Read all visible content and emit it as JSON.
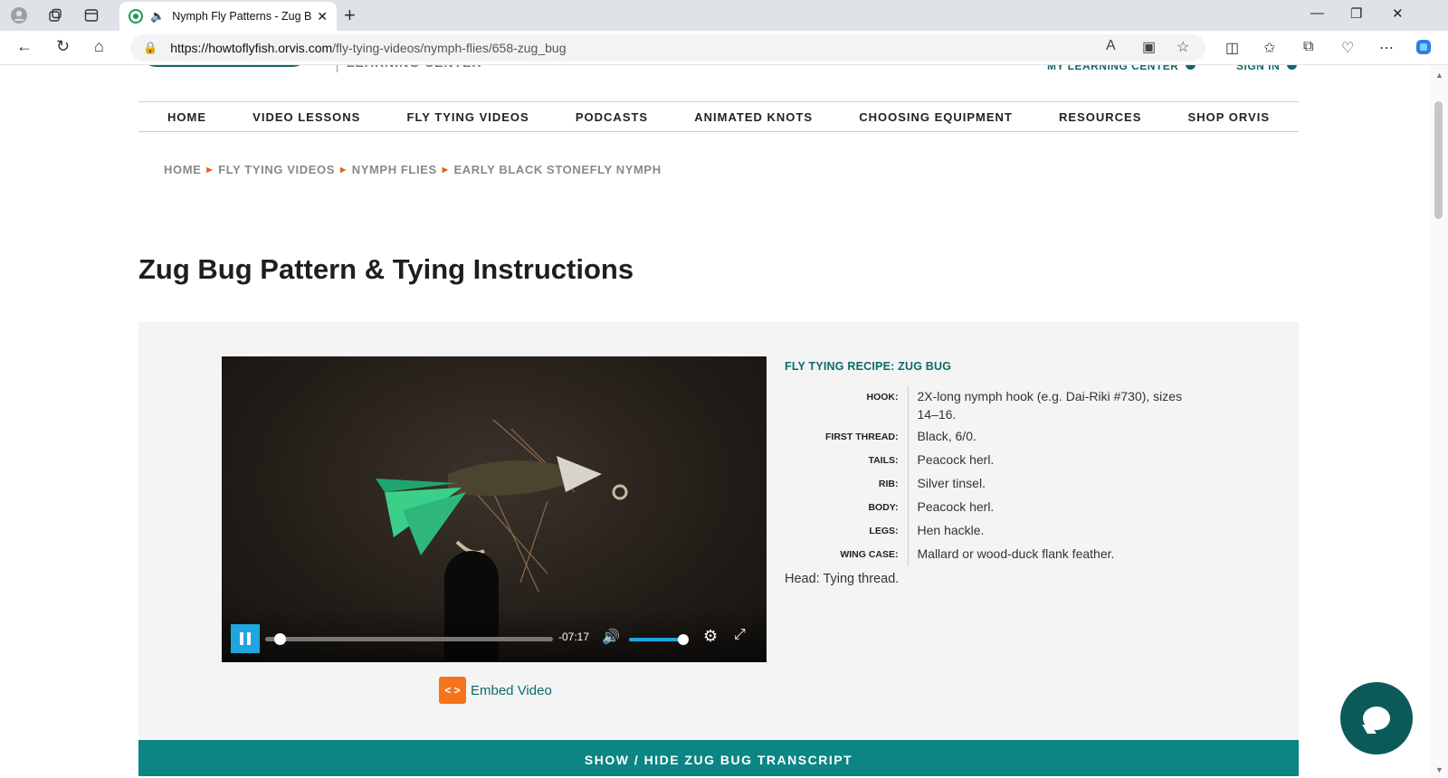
{
  "browser": {
    "tab_title": "Nymph Fly Patterns - Zug Bu",
    "tab_close": "✕",
    "new_tab": "+",
    "url_host": "https://howtoflyfish.orvis.com",
    "url_path": "/fly-tying-videos/nymph-flies/658-zug_bug"
  },
  "header": {
    "logo_subtitle": "LEARNING CENTER",
    "my_learning_center": "MY LEARNING CENTER",
    "sign_in": "SIGN IN"
  },
  "nav": {
    "items": [
      "HOME",
      "VIDEO LESSONS",
      "FLY TYING VIDEOS",
      "PODCASTS",
      "ANIMATED KNOTS",
      "CHOOSING EQUIPMENT",
      "RESOURCES",
      "SHOP ORVIS"
    ]
  },
  "breadcrumb": [
    "HOME",
    "FLY TYING VIDEOS",
    "NYMPH FLIES",
    "EARLY BLACK STONEFLY NYMPH"
  ],
  "page_title": "Zug Bug Pattern & Tying Instructions",
  "video": {
    "time_remaining": "-07:17",
    "progress_fraction": 0.03,
    "volume_fraction": 1.0,
    "embed_icon": "< >",
    "embed_label": "Embed Video"
  },
  "recipe": {
    "heading": "FLY TYING RECIPE: ZUG BUG",
    "rows": [
      {
        "key": "HOOK:",
        "value": "2X-long nymph hook (e.g. Dai-Riki #730), sizes 14–16."
      },
      {
        "key": "FIRST THREAD:",
        "value": "Black, 6/0."
      },
      {
        "key": "TAILS:",
        "value": "Peacock herl."
      },
      {
        "key": "RIB:",
        "value": "Silver tinsel."
      },
      {
        "key": "BODY:",
        "value": "Peacock herl."
      },
      {
        "key": "LEGS:",
        "value": "Hen hackle."
      },
      {
        "key": "WING CASE:",
        "value": "Mallard or wood-duck flank feather."
      }
    ],
    "extra": "Head: Tying thread."
  },
  "transcript_label": "SHOW / HIDE ZUG BUG TRANSCRIPT",
  "colors": {
    "brand_teal": "#0e6a6a",
    "accent_orange": "#f4731d",
    "player_blue": "#1fa6e0",
    "transcript_bar": "#0c8585"
  }
}
